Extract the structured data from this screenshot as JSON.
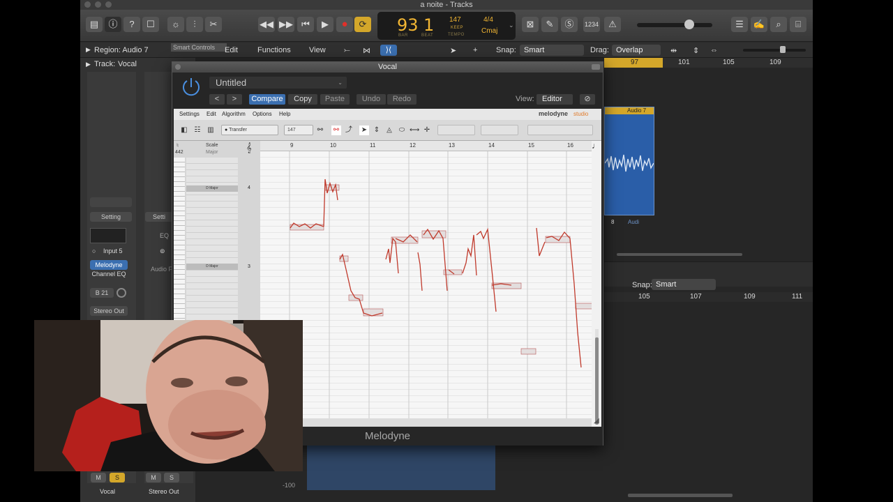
{
  "window": {
    "title": "a noite - Tracks"
  },
  "transport": {
    "bar": "93",
    "beat": "1",
    "bar_label": "BAR",
    "beat_label": "BEAT",
    "tempo": "147",
    "tempo_mode": "KEEP",
    "tempo_label": "TEMPO",
    "signature": "4/4",
    "key": "Cmaj",
    "count_in": "1234"
  },
  "bar2": {
    "region_label": "Region: Audio 7",
    "track_label": "Track:",
    "track_name": "Vocal",
    "smart_controls_tooltip": "Smart Controls",
    "menus": [
      "Edit",
      "Functions",
      "View"
    ],
    "snap_label": "Snap:",
    "snap_value": "Smart",
    "drag_label": "Drag:",
    "drag_value": "Overlap"
  },
  "ruler_top": [
    "97",
    "101",
    "105",
    "109"
  ],
  "ruler_bottom": [
    "105",
    "107",
    "109",
    "111"
  ],
  "lower_snap": {
    "label": "Snap:",
    "value": "Smart"
  },
  "region": {
    "name": "Audio 7",
    "track_number": "8",
    "sub_label": "Audi"
  },
  "inspector": {
    "setting_1": "Setting",
    "setting_2": "Setti",
    "eq_label": "EQ",
    "input": "Input 5",
    "audio_fx": "Audio F",
    "plugin_slot": "Melodyne",
    "channel_eq": "Channel EQ",
    "bus": "B 21",
    "output": "Stereo Out",
    "m": "M",
    "s": "S",
    "channel_1": "Vocal",
    "channel_2": "Stereo Out",
    "meter_value": "-100"
  },
  "plugin": {
    "title": "Vocal",
    "preset": "Untitled",
    "compare": "Compare",
    "copy": "Copy",
    "paste": "Paste",
    "undo": "Undo",
    "redo": "Redo",
    "view_label": "View:",
    "view_value": "Editor",
    "menu": [
      "Settings",
      "Edit",
      "Algorithm",
      "Options",
      "Help"
    ],
    "brand": "melodyne",
    "brand_suffix": "studio",
    "transfer": "Transfer",
    "tempo": "147",
    "scale_header": "Scale",
    "pitch_ref": "442",
    "scale_major": "Major",
    "note_labels": [
      {
        "name": "D Major",
        "oct": "4"
      },
      {
        "name": "D Major",
        "oct": "3"
      }
    ],
    "bar_numbers": [
      "9",
      "10",
      "11",
      "12",
      "13",
      "14",
      "15",
      "16"
    ],
    "footer": "Melodyne"
  },
  "colors": {
    "accent_blue": "#3b6fb0",
    "lcd_amber": "#f2b633",
    "cycle_yellow": "#d4a72a",
    "record_red": "#e0302a",
    "region_blue": "#2a5ea8",
    "blob_red": "#c0392b"
  },
  "icons": [
    "library-icon",
    "info-icon",
    "help-icon",
    "editors-icon",
    "settings-icon",
    "mixer-icon",
    "scissors-icon",
    "rewind-icon",
    "forward-icon",
    "to-start-icon",
    "play-icon",
    "record-icon",
    "cycle-icon",
    "tuner-icon",
    "pencil-icon",
    "solo-icon",
    "metronome-icon",
    "list-icon",
    "notepad-icon",
    "search-icon",
    "browser-icon",
    "power-icon",
    "link-icon"
  ]
}
